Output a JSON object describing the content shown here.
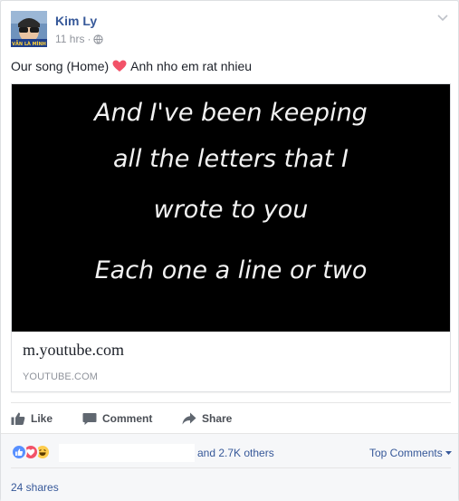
{
  "post": {
    "author": "Kim Ly",
    "time": "11 hrs",
    "separator": "·",
    "text": "Our song (Home)",
    "text_after": "Anh nho em rat nhieu",
    "heart_color": "#f25268"
  },
  "avatar": {
    "caption": "VẪN LÀ MÌNH"
  },
  "link": {
    "video_lyrics": [
      "And I've been keeping",
      "all the letters that I",
      "wrote to you",
      "Each one a line or two"
    ],
    "title": "m.youtube.com",
    "domain": "YOUTUBE.COM"
  },
  "actions": {
    "like": "Like",
    "comment": "Comment",
    "share": "Share"
  },
  "footer": {
    "reactions": [
      "like",
      "love",
      "haha"
    ],
    "others": "and 2.7K others",
    "top_comments": "Top Comments",
    "shares": "24 shares"
  },
  "colors": {
    "link_blue": "#365899",
    "like_blue": "#5890ff",
    "love_red": "#f25268",
    "haha_yellow": "#fdcc4e"
  }
}
